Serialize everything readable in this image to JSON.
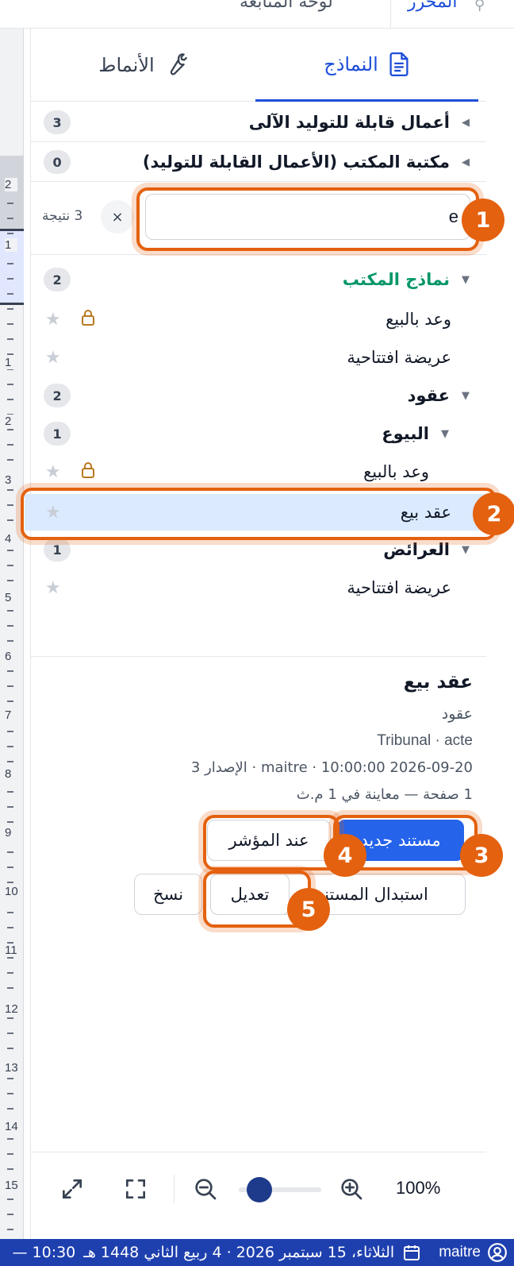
{
  "topbar": {
    "tabs": [
      "المحرر",
      "لوحة المتابعة"
    ]
  },
  "panel_tabs": {
    "models": "النماذج",
    "styles": "الأنماط"
  },
  "groups": {
    "auto": {
      "label": "أعمال قابلة للتوليد الآلى",
      "count": "3"
    },
    "library": {
      "label": "مكتبة المكتب (الأعمال القابلة للتوليد)",
      "count": "0"
    }
  },
  "search": {
    "value": "e",
    "clear": "×",
    "results": "3 نتيجة"
  },
  "tree": {
    "office": {
      "label": "نماذج المكتب",
      "count": "2",
      "items": [
        "وعد بالبيع",
        "عريضة افتتاحية"
      ]
    },
    "contracts": {
      "label": "عقود",
      "count": "2"
    },
    "sales": {
      "label": "البيوع",
      "count": "1",
      "items": [
        "وعد بالبيع",
        "عقد بيع"
      ]
    },
    "petitions": {
      "label": "العرائض",
      "count": "1",
      "items": [
        "عريضة افتتاحية"
      ]
    }
  },
  "details": {
    "title": "عقد بيع",
    "category": "عقود",
    "tags": "Tribunal · acte",
    "meta": "2026-09-20 10:00:00 · maitre · الإصدار 3",
    "preview": "1 صفحة — معاينة في 1 م.ث"
  },
  "buttons": {
    "new_doc": "مستند جديد",
    "at_cursor": "عند المؤشر",
    "replace": "استبدال المستند",
    "edit": "تعديل",
    "copy": "نسخ"
  },
  "callouts": [
    "1",
    "2",
    "3",
    "4",
    "5"
  ],
  "zoom": {
    "level": "100%",
    "slider_fraction": 0.25
  },
  "statusbar": {
    "user": "maitre",
    "date": "الثلاثاء، 15 سبتمبر 2026 · 4 ربيع الثاني 1448 هـ",
    "time": "10:30 —"
  },
  "ruler": {
    "numbers": [
      "2",
      "1",
      "1",
      "2",
      "3",
      "4",
      "5",
      "6",
      "7",
      "8",
      "9",
      "10",
      "11",
      "12",
      "13",
      "14",
      "15"
    ]
  },
  "colors": {
    "accent": "#1d4ed8",
    "callout": "#e4610f",
    "selection": "#dbeafe",
    "status": "#1e40af",
    "office_group": "#059669",
    "lock": "#b7791f"
  }
}
